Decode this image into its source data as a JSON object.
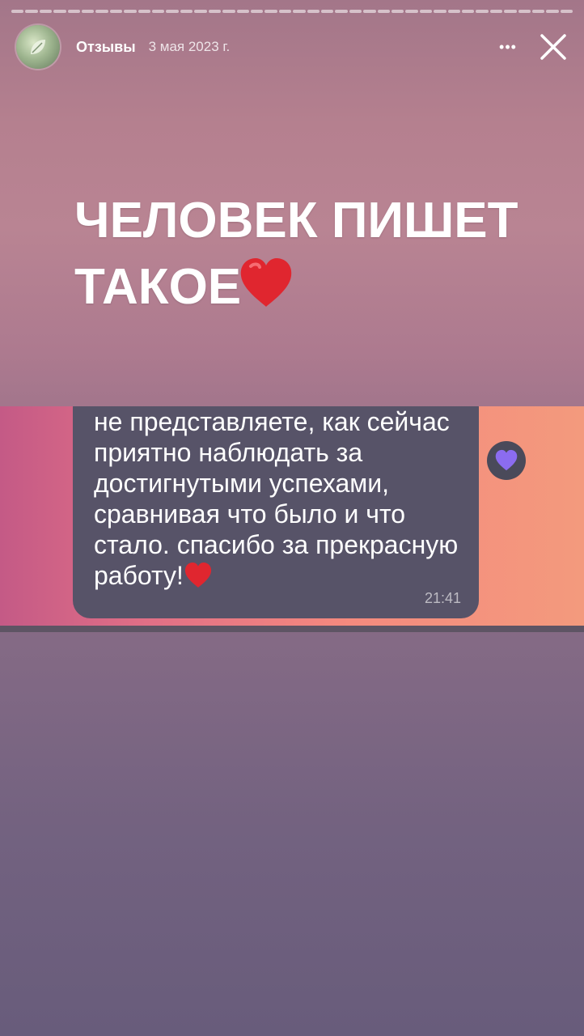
{
  "story": {
    "segments": 40,
    "account_name": "Отзывы",
    "date": "3 мая 2023 г.",
    "more_label": "•••",
    "headline_line1": "ЧЕЛОВЕК ПИШЕТ",
    "headline_line2": "ТАКОЕ"
  },
  "message": {
    "text_before_emoji": "не представляете, как сейчас приятно наблюдать за достигнутыми успехами, сравнивая что было и что стало. спасибо за прекрасную работу!",
    "time": "21:41",
    "reaction": "purple-heart-icon"
  },
  "colors": {
    "bubble": "#575368",
    "heart": "#e0262f",
    "reaction_heart": "#8b6cf0"
  }
}
